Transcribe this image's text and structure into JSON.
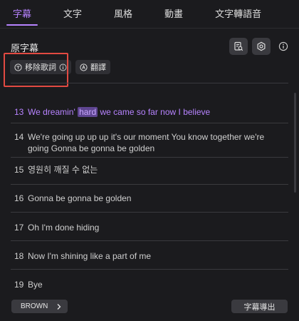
{
  "tabs": [
    {
      "label": "字幕",
      "active": true
    },
    {
      "label": "文字",
      "active": false
    },
    {
      "label": "風格",
      "active": false
    },
    {
      "label": "動畫",
      "active": false
    },
    {
      "label": "文字轉語音",
      "active": false
    }
  ],
  "section": {
    "title": "原字幕"
  },
  "header_icons": [
    "subtitle-search-icon",
    "settings-icon",
    "info-icon"
  ],
  "actions": {
    "remove_lyrics": {
      "label": "移除歌詞",
      "icon": "lyrics-icon",
      "info_icon": "info-icon"
    },
    "translate": {
      "label": "翻譯",
      "icon": "translate-icon"
    }
  },
  "lines": [
    {
      "num": "13",
      "before": "We dreamin' ",
      "highlight": "hard",
      "after": " we came so far now I believe",
      "current": true
    },
    {
      "num": "14",
      "text": "We're going up up up it's our moment You know together we're going Gonna be gonna be golden"
    },
    {
      "num": "15",
      "text": "영원히 깨질 수 없는"
    },
    {
      "num": "16",
      "text": "Gonna be gonna be golden"
    },
    {
      "num": "17",
      "text": "Oh I'm done hiding"
    },
    {
      "num": "18",
      "text": "Now I'm shining like a part of me"
    },
    {
      "num": "19",
      "text": "Bye"
    }
  ],
  "footer": {
    "style_label": "BROWN",
    "export_label": "字幕導出"
  },
  "colors": {
    "accent": "#b783ff",
    "background": "#1b1b1e",
    "annotation_box": "#e24a42"
  }
}
